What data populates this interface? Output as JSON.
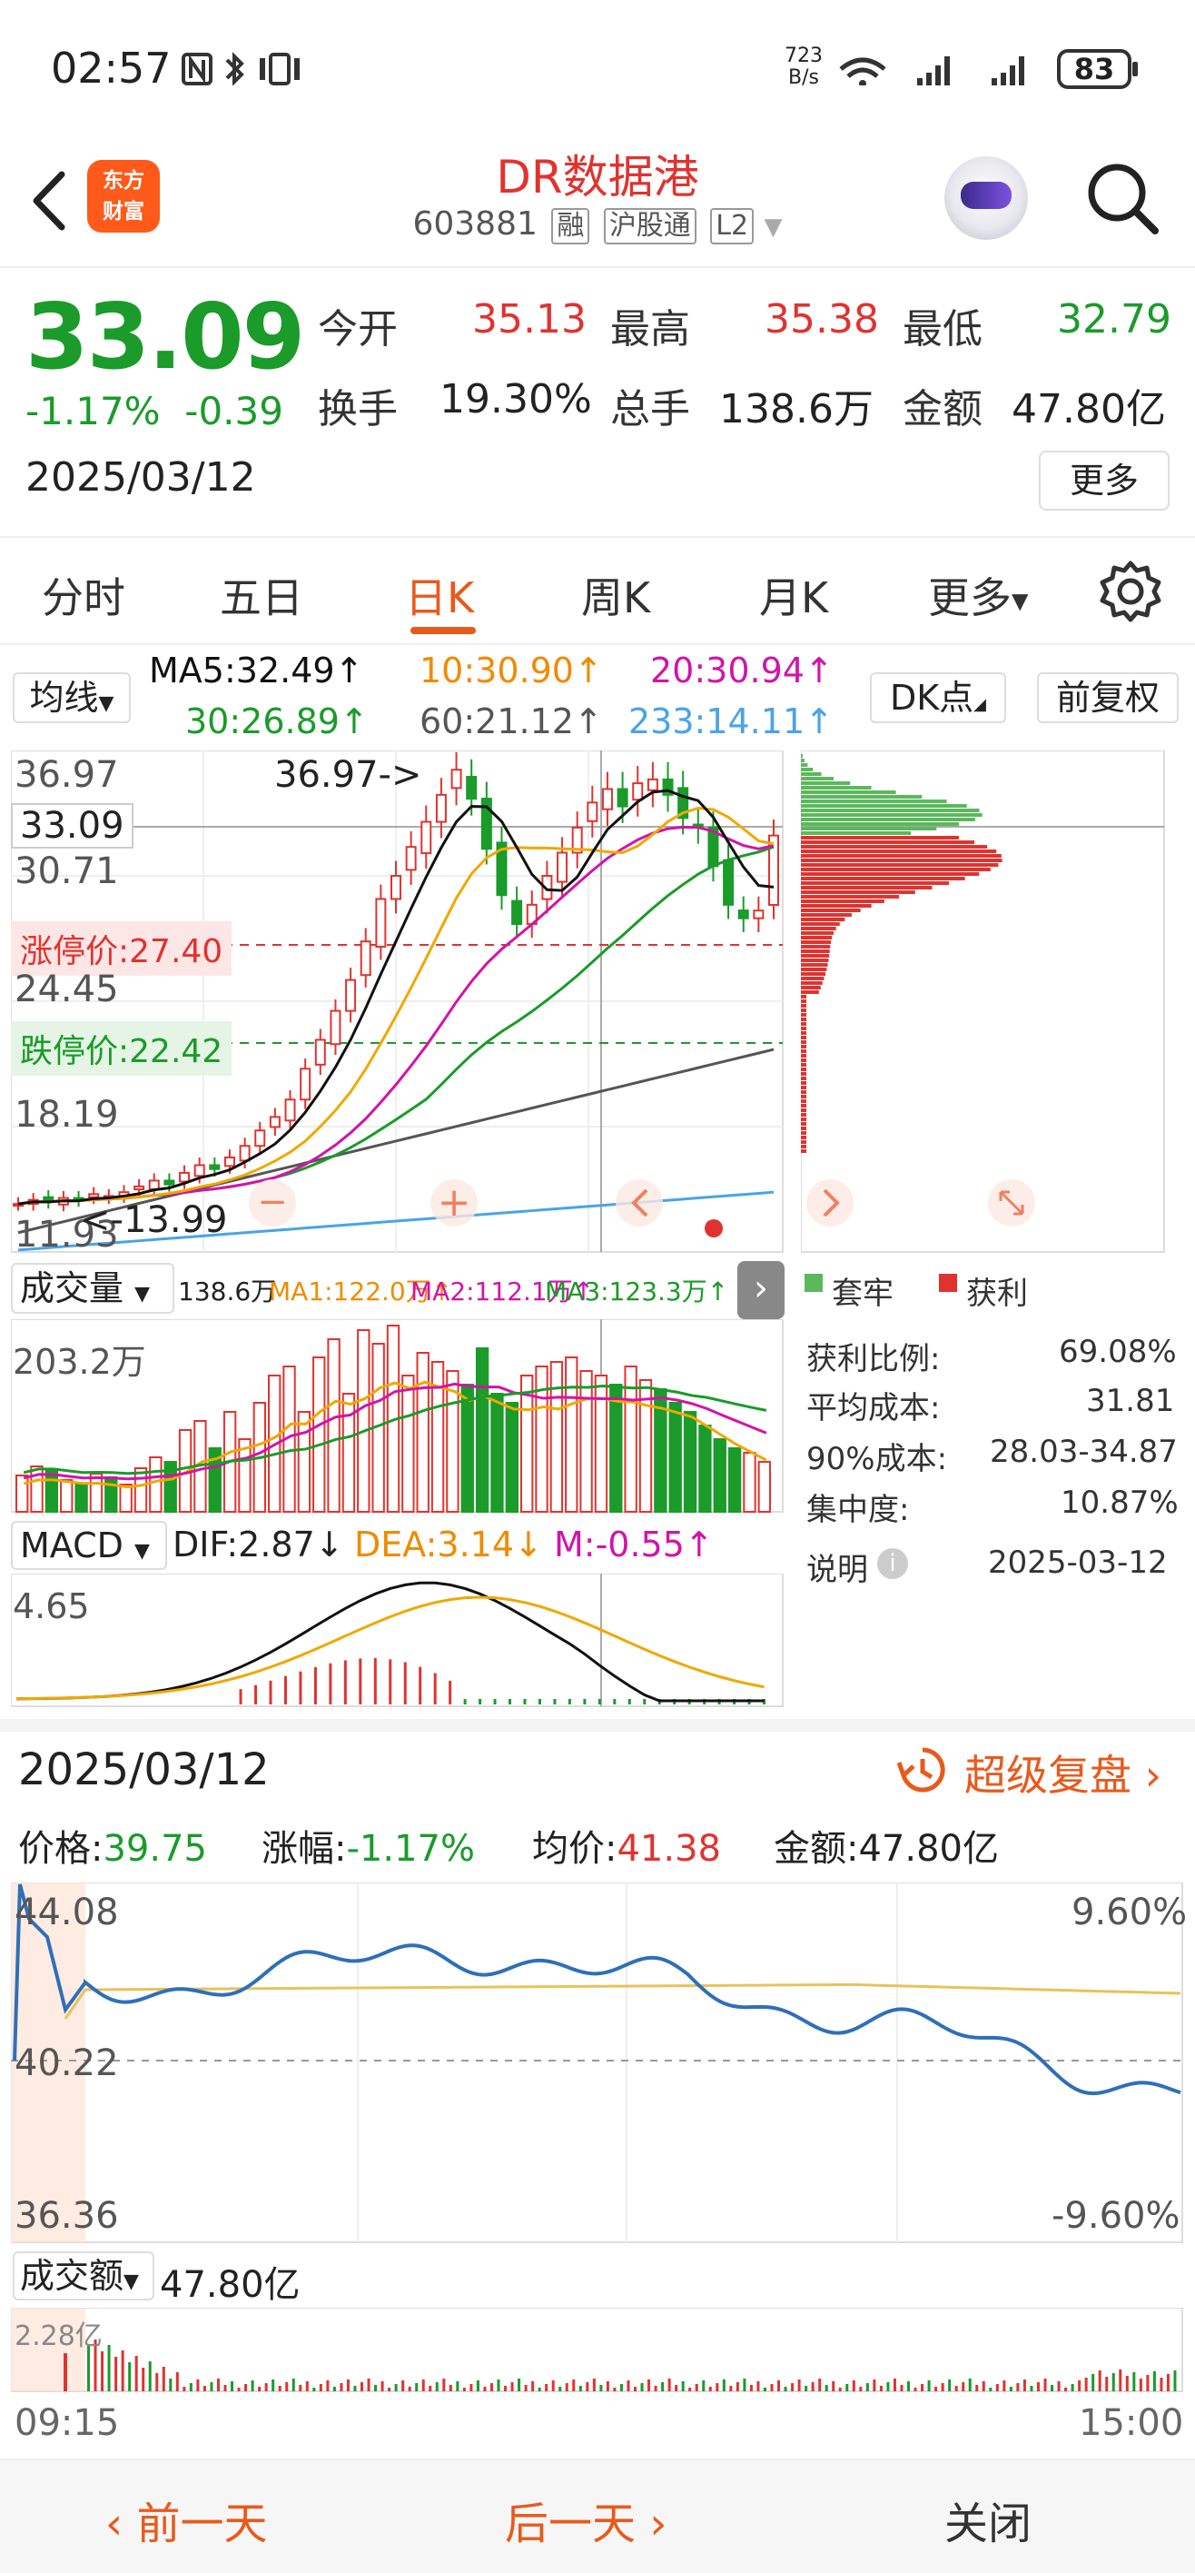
{
  "status": {
    "time": "02:57",
    "net_speed_value": "723",
    "net_speed_unit": "B/s",
    "battery": "83"
  },
  "header": {
    "title": "DR数据港",
    "code": "603881",
    "tags": [
      "融",
      "沪股通",
      "L2"
    ],
    "logo_line1": "东方",
    "logo_line2": "财富"
  },
  "quote": {
    "price": "33.09",
    "change_pct": "-1.17%",
    "change": "-0.39",
    "date": "2025/03/12",
    "open_label": "今开",
    "open": "35.13",
    "high_label": "最高",
    "high": "35.38",
    "low_label": "最低",
    "low": "32.79",
    "turnover_label": "换手",
    "turnover": "19.30%",
    "volume_label": "总手",
    "volume": "138.6万",
    "amount_label": "金额",
    "amount": "47.80亿",
    "more": "更多"
  },
  "tabs": [
    "分时",
    "五日",
    "日K",
    "周K",
    "月K",
    "更多"
  ],
  "ma": {
    "selector": "均线",
    "ma5": "MA5:32.49↑",
    "ma10": "10:30.90↑",
    "ma20": "20:30.94↑",
    "ma30": "30:26.89↑",
    "ma60": "60:21.12↑",
    "ma233": "233:14.11↑",
    "dk": "DK点",
    "adjust": "前复权"
  },
  "kline": {
    "y_labels": [
      "36.97",
      "30.71",
      "24.45",
      "18.19",
      "11.93"
    ],
    "current_price_tag": "33.09",
    "limit_up": "涨停价:27.40",
    "limit_down": "跌停价:22.42",
    "high_marker": "36.97->",
    "low_marker": "<-13.99"
  },
  "chip": {
    "legend_trap": "套牢",
    "legend_profit": "获利",
    "profit_ratio_label": "获利比例:",
    "profit_ratio": "69.08%",
    "avg_cost_label": "平均成本:",
    "avg_cost": "31.81",
    "cost90_label": "90%成本:",
    "cost90": "28.03-34.87",
    "concentration_label": "集中度:",
    "concentration": "10.87%",
    "explain": "说明",
    "date": "2025-03-12"
  },
  "volume": {
    "selector": "成交量",
    "total": "138.6万",
    "ma1": "MA1:122.0万↑",
    "ma2": "MA2:112.1万↑",
    "ma3": "MA3:123.3万↑",
    "max": "203.2万"
  },
  "macd": {
    "selector": "MACD",
    "dif": "DIF:2.87↓",
    "dea": "DEA:3.14↓",
    "m": "M:-0.55↑",
    "max": "4.65"
  },
  "replay": {
    "date": "2025/03/12",
    "super_replay": "超级复盘",
    "price_label": "价格:",
    "price": "39.75",
    "change_label": "涨幅:",
    "change": "-1.17%",
    "avg_label": "均价:",
    "avg": "41.38",
    "amount_label": "金额:",
    "amount": "47.80亿",
    "y_top": "44.08",
    "y_mid": "40.22",
    "y_bot": "36.36",
    "pct_top": "9.60%",
    "pct_bot": "-9.60%",
    "amount_selector": "成交额",
    "amount_total": "47.80亿",
    "amount_max": "2.28亿",
    "time_start": "09:15",
    "time_end": "15:00"
  },
  "bottom_nav": {
    "prev": "前一天",
    "next": "后一天",
    "close": "关闭"
  },
  "colors": {
    "up": "#e0332f",
    "down": "#1a9b2a",
    "accent": "#e85a1c",
    "ma5": "#111111",
    "ma10": "#f0a800",
    "ma20": "#d214a8",
    "ma30": "#1a9b2a",
    "ma60": "#555555",
    "ma233": "#4aa3e8"
  }
}
